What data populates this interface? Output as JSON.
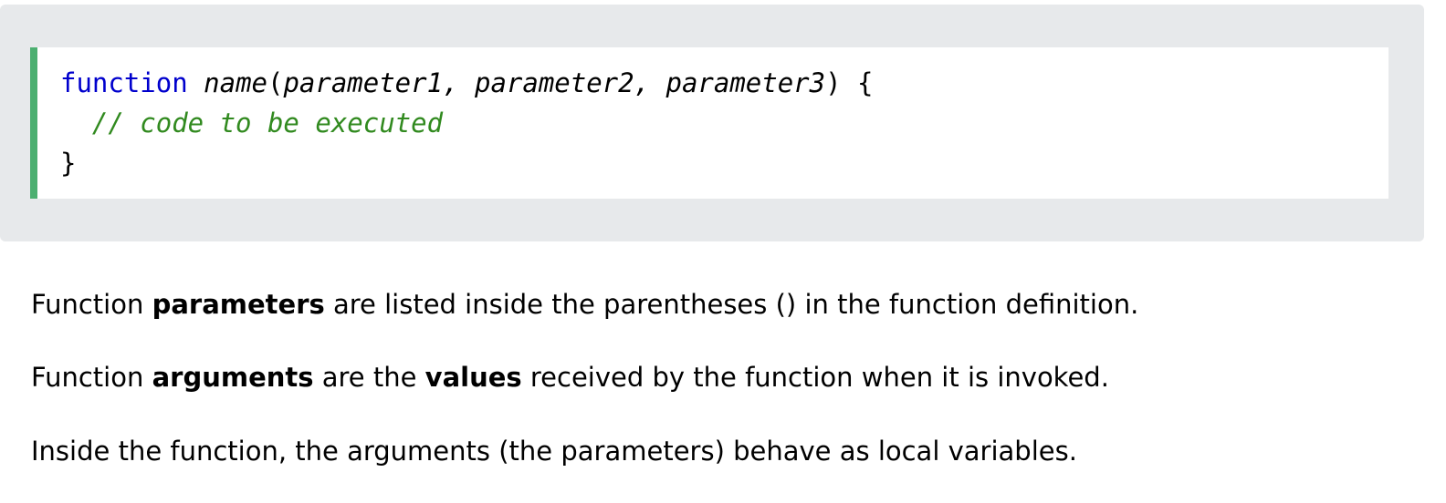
{
  "code": {
    "line1": {
      "keyword": "function",
      "space": " ",
      "name": "name",
      "open_paren": "(",
      "params": "parameter1, parameter2, parameter3",
      "close": ") {"
    },
    "line2": {
      "indent": "  ",
      "comment": "// code to be executed"
    },
    "line3": {
      "brace": "}"
    }
  },
  "paragraphs": [
    {
      "before": "Function ",
      "bold": "parameters",
      "after": " are listed inside the parentheses () in the function definition."
    },
    {
      "before": "Function ",
      "bold1": "arguments",
      "middle": " are the ",
      "bold2": "values",
      "after": " received by the function when it is invoked."
    },
    {
      "text": "Inside the function, the arguments (the parameters) behave as local variables."
    }
  ],
  "colors": {
    "panel_bg": "#e7e9eb",
    "code_border": "#4caf70",
    "keyword": "#0000cd",
    "comment": "#318a1f"
  }
}
